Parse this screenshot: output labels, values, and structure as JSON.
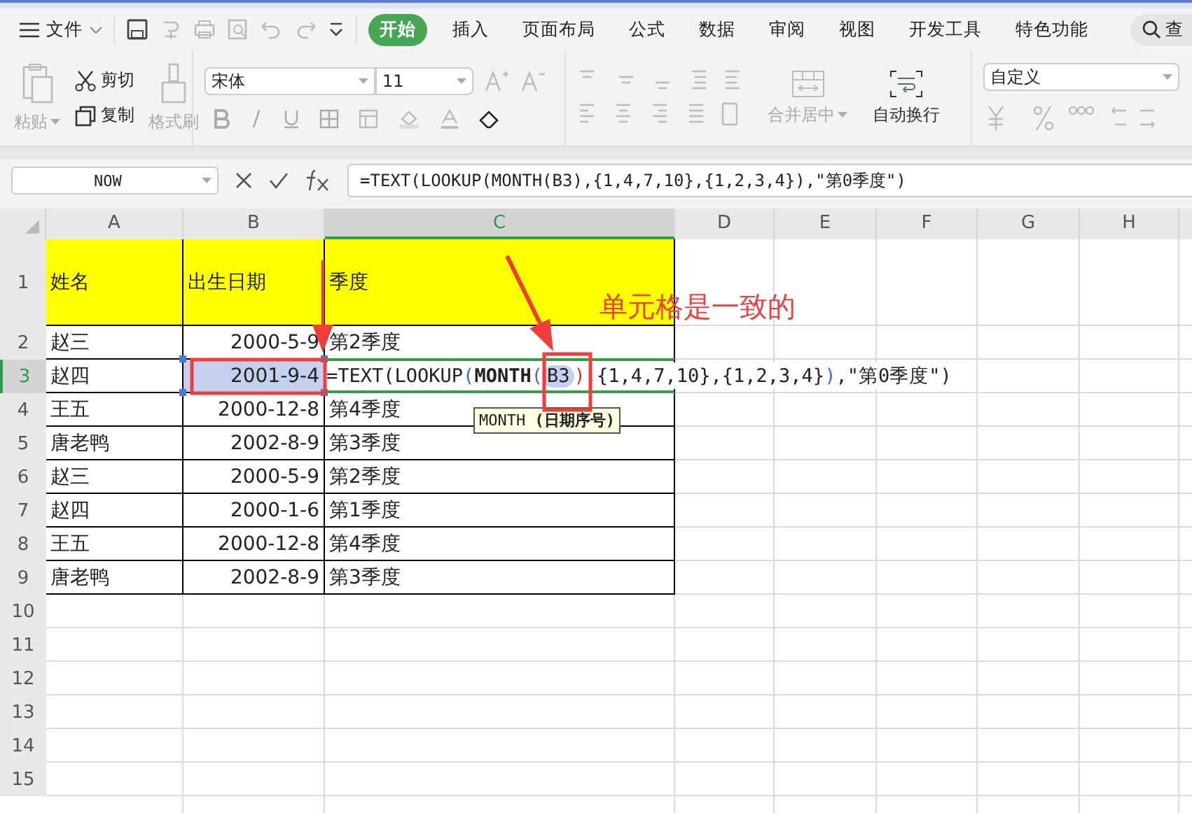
{
  "menu": {
    "file": "文件",
    "search": "查"
  },
  "menu_tabs": [
    {
      "label": "开始",
      "selected": true
    },
    {
      "label": "插入",
      "selected": false
    },
    {
      "label": "页面布局",
      "selected": false
    },
    {
      "label": "公式",
      "selected": false
    },
    {
      "label": "数据",
      "selected": false
    },
    {
      "label": "审阅",
      "selected": false
    },
    {
      "label": "视图",
      "selected": false
    },
    {
      "label": "开发工具",
      "selected": false
    },
    {
      "label": "特色功能",
      "selected": false
    }
  ],
  "ribbon": {
    "paste": {
      "label": "粘贴",
      "disabled": true
    },
    "cut": {
      "label": "剪切",
      "disabled": false
    },
    "copy": {
      "label": "复制",
      "disabled": false
    },
    "format_painter": {
      "label": "格式刷",
      "disabled": true
    },
    "font_name": "宋体",
    "font_size": "11",
    "merge": {
      "label": "合并居中",
      "disabled": true
    },
    "wrap": {
      "label": "自动换行",
      "disabled": false
    },
    "number_format": "自定义"
  },
  "formula_bar": {
    "name_box": "NOW",
    "formula": "=TEXT(LOOKUP(MONTH(B3),{1,4,7,10},{1,2,3,4}),\"第0季度\")"
  },
  "columns": [
    {
      "label": "A",
      "selected": false
    },
    {
      "label": "B",
      "selected": false
    },
    {
      "label": "C",
      "selected": true
    },
    {
      "label": "D",
      "selected": false
    },
    {
      "label": "E",
      "selected": false
    },
    {
      "label": "F",
      "selected": false
    },
    {
      "label": "G",
      "selected": false
    },
    {
      "label": "H",
      "selected": false
    }
  ],
  "rows": [
    {
      "label": "1",
      "selected": false,
      "kind": "header",
      "cells": [
        {
          "text": "姓名",
          "kind": "text",
          "selected": false
        },
        {
          "text": "出生日期",
          "kind": "text",
          "selected": false
        },
        {
          "text": "季度",
          "kind": "text",
          "selected": false
        }
      ]
    },
    {
      "label": "2",
      "selected": false,
      "kind": "data",
      "cells": [
        {
          "text": "赵三",
          "kind": "text",
          "selected": false
        },
        {
          "text": "2000-5-9",
          "kind": "number",
          "selected": false
        },
        {
          "text": "第2季度",
          "kind": "text",
          "selected": false
        }
      ]
    },
    {
      "label": "3",
      "selected": true,
      "kind": "data",
      "cells": [
        {
          "text": "赵四",
          "kind": "text",
          "selected": false
        },
        {
          "text": "2001-9-4",
          "kind": "number",
          "selected": true
        },
        {
          "kind": "editor",
          "selected": false,
          "parts": [
            {
              "text": "=TEXT(LOOKUP",
              "kind": "plain"
            },
            {
              "text": "(",
              "kind": "paren"
            },
            {
              "text": "MONTH",
              "kind": "bold"
            },
            {
              "text": "(",
              "kind": "paren"
            },
            {
              "text": "B3",
              "kind": "ref"
            },
            {
              "text": ")",
              "kind": "close"
            },
            {
              "text": ",{1,4,7,10},{1,2,3,4}",
              "kind": "plain"
            },
            {
              "text": ")",
              "kind": "paren"
            },
            {
              "text": ",\"第0季度\")",
              "kind": "plain"
            }
          ]
        }
      ]
    },
    {
      "label": "4",
      "selected": false,
      "kind": "data",
      "cells": [
        {
          "text": "王五",
          "kind": "text",
          "selected": false
        },
        {
          "text": "2000-12-8",
          "kind": "number",
          "selected": false
        },
        {
          "text": "第4季度",
          "kind": "text",
          "selected": false
        }
      ]
    },
    {
      "label": "5",
      "selected": false,
      "kind": "data",
      "cells": [
        {
          "text": "唐老鸭",
          "kind": "text",
          "selected": false
        },
        {
          "text": "2002-8-9",
          "kind": "number",
          "selected": false
        },
        {
          "text": "第3季度",
          "kind": "text",
          "selected": false
        }
      ]
    },
    {
      "label": "6",
      "selected": false,
      "kind": "data",
      "cells": [
        {
          "text": "赵三",
          "kind": "text",
          "selected": false
        },
        {
          "text": "2000-5-9",
          "kind": "number",
          "selected": false
        },
        {
          "text": "第2季度",
          "kind": "text",
          "selected": false
        }
      ]
    },
    {
      "label": "7",
      "selected": false,
      "kind": "data",
      "cells": [
        {
          "text": "赵四",
          "kind": "text",
          "selected": false
        },
        {
          "text": "2000-1-6",
          "kind": "number",
          "selected": false
        },
        {
          "text": "第1季度",
          "kind": "text",
          "selected": false
        }
      ]
    },
    {
      "label": "8",
      "selected": false,
      "kind": "data",
      "cells": [
        {
          "text": "王五",
          "kind": "text",
          "selected": false
        },
        {
          "text": "2000-12-8",
          "kind": "number",
          "selected": false
        },
        {
          "text": "第4季度",
          "kind": "text",
          "selected": false
        }
      ]
    },
    {
      "label": "9",
      "selected": false,
      "kind": "data",
      "cells": [
        {
          "text": "唐老鸭",
          "kind": "text",
          "selected": false
        },
        {
          "text": "2002-8-9",
          "kind": "number",
          "selected": false
        },
        {
          "text": "第3季度",
          "kind": "text",
          "selected": false
        }
      ]
    },
    {
      "label": "10",
      "selected": false,
      "kind": "empty",
      "cells": []
    },
    {
      "label": "11",
      "selected": false,
      "kind": "empty",
      "cells": []
    },
    {
      "label": "12",
      "selected": false,
      "kind": "empty",
      "cells": []
    },
    {
      "label": "13",
      "selected": false,
      "kind": "empty",
      "cells": []
    },
    {
      "label": "14",
      "selected": false,
      "kind": "empty",
      "cells": []
    },
    {
      "label": "15",
      "selected": false,
      "kind": "empty",
      "cells": []
    }
  ],
  "tooltip": "MONTH **(日期序号)**",
  "annotation": "单元格是一致的"
}
